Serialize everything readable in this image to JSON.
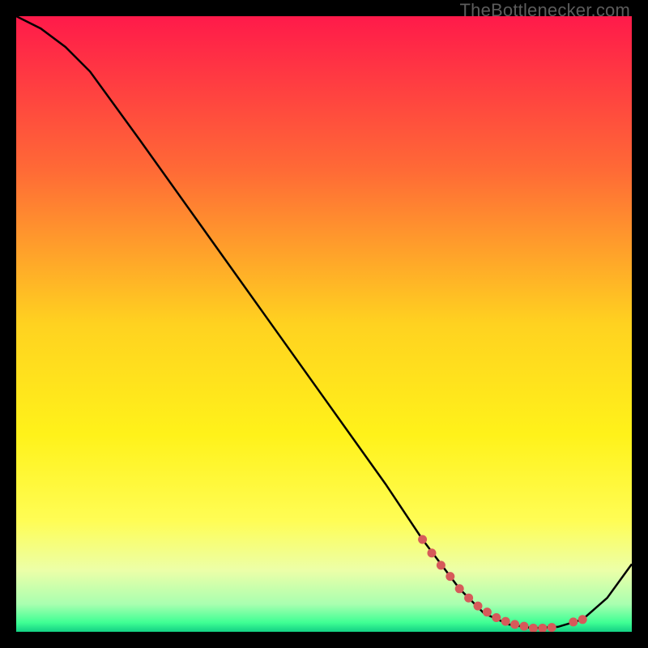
{
  "watermark": "TheBottlenecker.com",
  "chart_data": {
    "type": "line",
    "title": "",
    "xlabel": "",
    "ylabel": "",
    "xlim": [
      0,
      100
    ],
    "ylim": [
      0,
      100
    ],
    "grid": false,
    "legend": false,
    "gradient_stops": [
      {
        "offset": 0.0,
        "color": "#ff1a4a"
      },
      {
        "offset": 0.25,
        "color": "#ff6a36"
      },
      {
        "offset": 0.5,
        "color": "#ffd220"
      },
      {
        "offset": 0.68,
        "color": "#fff21a"
      },
      {
        "offset": 0.82,
        "color": "#fffd55"
      },
      {
        "offset": 0.9,
        "color": "#ecffa8"
      },
      {
        "offset": 0.955,
        "color": "#a9ffb0"
      },
      {
        "offset": 0.985,
        "color": "#3fff94"
      },
      {
        "offset": 1.0,
        "color": "#13d184"
      }
    ],
    "series": [
      {
        "name": "bottleneck-curve",
        "x": [
          0,
          4,
          8,
          12,
          20,
          30,
          40,
          50,
          60,
          66,
          72,
          76,
          80,
          84,
          88,
          92,
          96,
          100
        ],
        "y": [
          100,
          98,
          95,
          91,
          80,
          66,
          52,
          38,
          24,
          15,
          7,
          3,
          1.2,
          0.6,
          0.8,
          2.0,
          5.5,
          11
        ]
      }
    ],
    "markers": {
      "name": "valley-dots",
      "color": "#d65a5a",
      "radius": 5.5,
      "x": [
        66,
        67.5,
        69,
        70.5,
        72,
        73.5,
        75,
        76.5,
        78,
        79.5,
        81,
        82.5,
        84,
        85.5,
        87,
        90.5,
        92
      ],
      "y": [
        15,
        12.8,
        10.8,
        9.0,
        7.0,
        5.5,
        4.2,
        3.2,
        2.3,
        1.7,
        1.2,
        0.9,
        0.6,
        0.6,
        0.7,
        1.6,
        2.0
      ]
    }
  }
}
